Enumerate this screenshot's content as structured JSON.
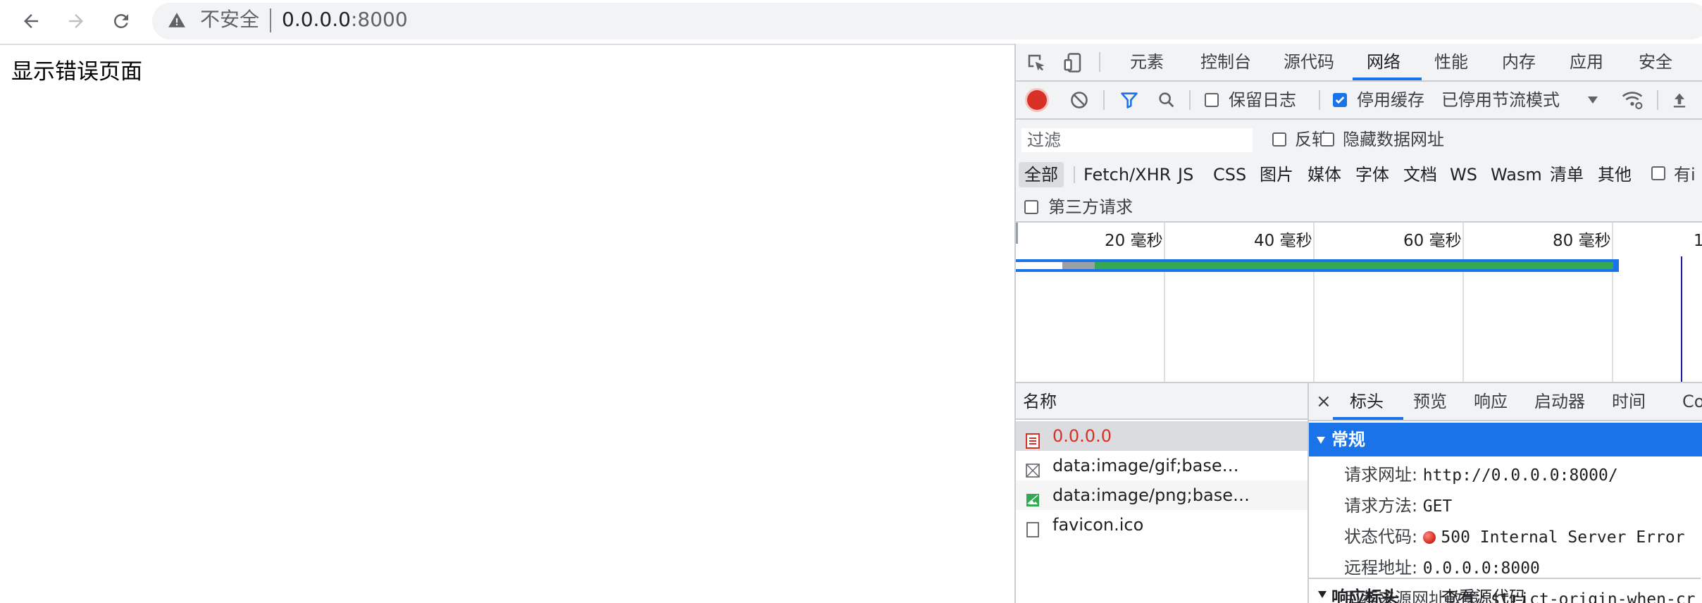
{
  "browser": {
    "security_label": "不安全",
    "url_host": "0.0.0.0",
    "url_port": ":8000"
  },
  "page": {
    "text": "显示错误页面"
  },
  "devtools": {
    "tabs": [
      "元素",
      "控制台",
      "源代码",
      "网络",
      "性能",
      "内存",
      "应用",
      "安全"
    ],
    "active_tab": "网络",
    "toolbar": {
      "preserve_log": "保留日志",
      "disable_cache": "停用缓存",
      "disable_cache_checked": true,
      "throttling": "已停用节流模式"
    },
    "filter": {
      "placeholder": "过滤",
      "invert": "反转",
      "hide_data_urls": "隐藏数据网址",
      "types": [
        "全部",
        "Fetch/XHR",
        "JS",
        "CSS",
        "图片",
        "媒体",
        "字体",
        "文档",
        "WS",
        "Wasm",
        "清单",
        "其他"
      ],
      "has_blocked_cookies": "有i",
      "third_party": "第三方请求"
    },
    "overview": {
      "ticks": [
        "20 毫秒",
        "40 毫秒",
        "60 毫秒",
        "80 毫秒",
        "1"
      ]
    },
    "requests": {
      "header": "名称",
      "rows": [
        {
          "name": "0.0.0.0",
          "type": "document",
          "error": true,
          "selected": true
        },
        {
          "name": "data:image/gif;base…",
          "type": "gif"
        },
        {
          "name": "data:image/png;base…",
          "type": "png"
        },
        {
          "name": "favicon.ico",
          "type": "file"
        }
      ]
    },
    "details": {
      "close": "×",
      "tabs": [
        "标头",
        "预览",
        "响应",
        "启动器",
        "时间",
        "Co"
      ],
      "active_tab": "标头",
      "general_title": "常规",
      "general": [
        {
          "key": "请求网址:",
          "value": "http://0.0.0.0:8000/"
        },
        {
          "key": "请求方法:",
          "value": "GET"
        },
        {
          "key": "状态代码:",
          "value": "500 Internal Server Error"
        },
        {
          "key": "远程地址:",
          "value": "0.0.0.0:8000"
        },
        {
          "key": "引荐来源网址政策:",
          "value": "strict-origin-when-cr"
        }
      ],
      "response_headers_title": "响应标头",
      "view_source": "查看源代码"
    },
    "colors": {
      "accent": "#1a73e8",
      "record": "#d93025",
      "error_text": "#d93025",
      "waterfall_green": "#34a853"
    }
  }
}
